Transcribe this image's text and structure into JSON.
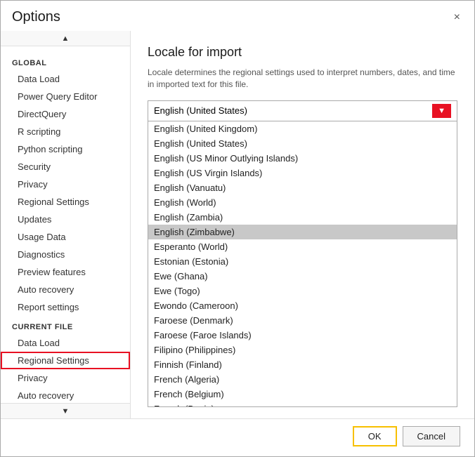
{
  "dialog": {
    "title": "Options",
    "close_icon": "×"
  },
  "sidebar": {
    "global_header": "GLOBAL",
    "global_items": [
      {
        "label": "Data Load",
        "id": "data-load",
        "active": false
      },
      {
        "label": "Power Query Editor",
        "id": "power-query-editor",
        "active": false
      },
      {
        "label": "DirectQuery",
        "id": "direct-query",
        "active": false
      },
      {
        "label": "R scripting",
        "id": "r-scripting",
        "active": false
      },
      {
        "label": "Python scripting",
        "id": "python-scripting",
        "active": false
      },
      {
        "label": "Security",
        "id": "security",
        "active": false
      },
      {
        "label": "Privacy",
        "id": "privacy",
        "active": false
      },
      {
        "label": "Regional Settings",
        "id": "regional-settings-global",
        "active": false
      },
      {
        "label": "Updates",
        "id": "updates",
        "active": false
      },
      {
        "label": "Usage Data",
        "id": "usage-data",
        "active": false
      },
      {
        "label": "Diagnostics",
        "id": "diagnostics",
        "active": false
      },
      {
        "label": "Preview features",
        "id": "preview-features",
        "active": false
      },
      {
        "label": "Auto recovery",
        "id": "auto-recovery-global",
        "active": false
      },
      {
        "label": "Report settings",
        "id": "report-settings",
        "active": false
      }
    ],
    "current_header": "CURRENT FILE",
    "current_items": [
      {
        "label": "Data Load",
        "id": "data-load-current",
        "active": false
      },
      {
        "label": "Regional Settings",
        "id": "regional-settings-current",
        "active": true
      },
      {
        "label": "Privacy",
        "id": "privacy-current",
        "active": false
      },
      {
        "label": "Auto recovery",
        "id": "auto-recovery-current",
        "active": false
      }
    ]
  },
  "main": {
    "title": "Locale for import",
    "description": "Locale determines the regional settings used to interpret numbers, dates, and time in imported text for this file.",
    "selected_locale": "English (United States)",
    "dropdown_arrow": "▼",
    "locale_options": [
      {
        "label": "English (United Kingdom)",
        "highlighted": false
      },
      {
        "label": "English (United States)",
        "highlighted": false
      },
      {
        "label": "English (US Minor Outlying Islands)",
        "highlighted": false
      },
      {
        "label": "English (US Virgin Islands)",
        "highlighted": false
      },
      {
        "label": "English (Vanuatu)",
        "highlighted": false
      },
      {
        "label": "English (World)",
        "highlighted": false
      },
      {
        "label": "English (Zambia)",
        "highlighted": false
      },
      {
        "label": "English (Zimbabwe)",
        "highlighted": true
      },
      {
        "label": "Esperanto (World)",
        "highlighted": false
      },
      {
        "label": "Estonian (Estonia)",
        "highlighted": false
      },
      {
        "label": "Ewe (Ghana)",
        "highlighted": false
      },
      {
        "label": "Ewe (Togo)",
        "highlighted": false
      },
      {
        "label": "Ewondo (Cameroon)",
        "highlighted": false
      },
      {
        "label": "Faroese (Denmark)",
        "highlighted": false
      },
      {
        "label": "Faroese (Faroe Islands)",
        "highlighted": false
      },
      {
        "label": "Filipino (Philippines)",
        "highlighted": false
      },
      {
        "label": "Finnish (Finland)",
        "highlighted": false
      },
      {
        "label": "French (Algeria)",
        "highlighted": false
      },
      {
        "label": "French (Belgium)",
        "highlighted": false
      },
      {
        "label": "French (Benin)",
        "highlighted": false
      }
    ]
  },
  "footer": {
    "ok_label": "OK",
    "cancel_label": "Cancel"
  }
}
